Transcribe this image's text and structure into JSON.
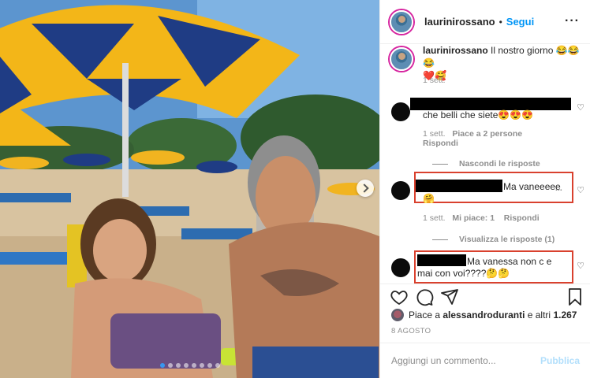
{
  "post": {
    "username": "laurinirossano",
    "separator": "•",
    "follow_label": "Segui",
    "more_icon": "more-horizontal-icon",
    "carousel": {
      "slide_count": 8,
      "active_index": 0
    }
  },
  "caption": {
    "username": "laurinirossano",
    "text": "Il nostro giorno 😂😂😂",
    "text_line2": "❤️🥰",
    "time": "1 sett."
  },
  "comments": [
    {
      "text": "che belli che siete😍😍😍",
      "time": "1 sett.",
      "likes": "Piace a 2 persone",
      "reply": "Rispondi",
      "toggle_replies": "Nascondi le risposte"
    },
    {
      "text": "Ma vaneeeee",
      "text_line2": "🤗",
      "time": "1 sett.",
      "likes": "Mi piace: 1",
      "reply": "Rispondi",
      "toggle_replies": "Visualizza le risposte (1)"
    },
    {
      "text": "Ma vanessa non c e",
      "text_line2": "mai con voi????🤔🤔",
      "time": "",
      "likes": "",
      "reply": ""
    }
  ],
  "footer": {
    "liked_by_prefix": "Piace a",
    "liked_by_user": "alessandroduranti",
    "liked_by_suffix": "e altri",
    "liked_by_count": "1.267",
    "date": "8 AGOSTO",
    "comment_placeholder": "Aggiungi un commento...",
    "publish_label": "Pubblica"
  },
  "colors": {
    "follow_blue": "#0095f6",
    "highlight_red": "#d9412e",
    "publish_disabled": "#b2dffc"
  },
  "icons": [
    "heart-icon",
    "comment-icon",
    "share-icon",
    "bookmark-icon",
    "next-arrow-icon"
  ]
}
